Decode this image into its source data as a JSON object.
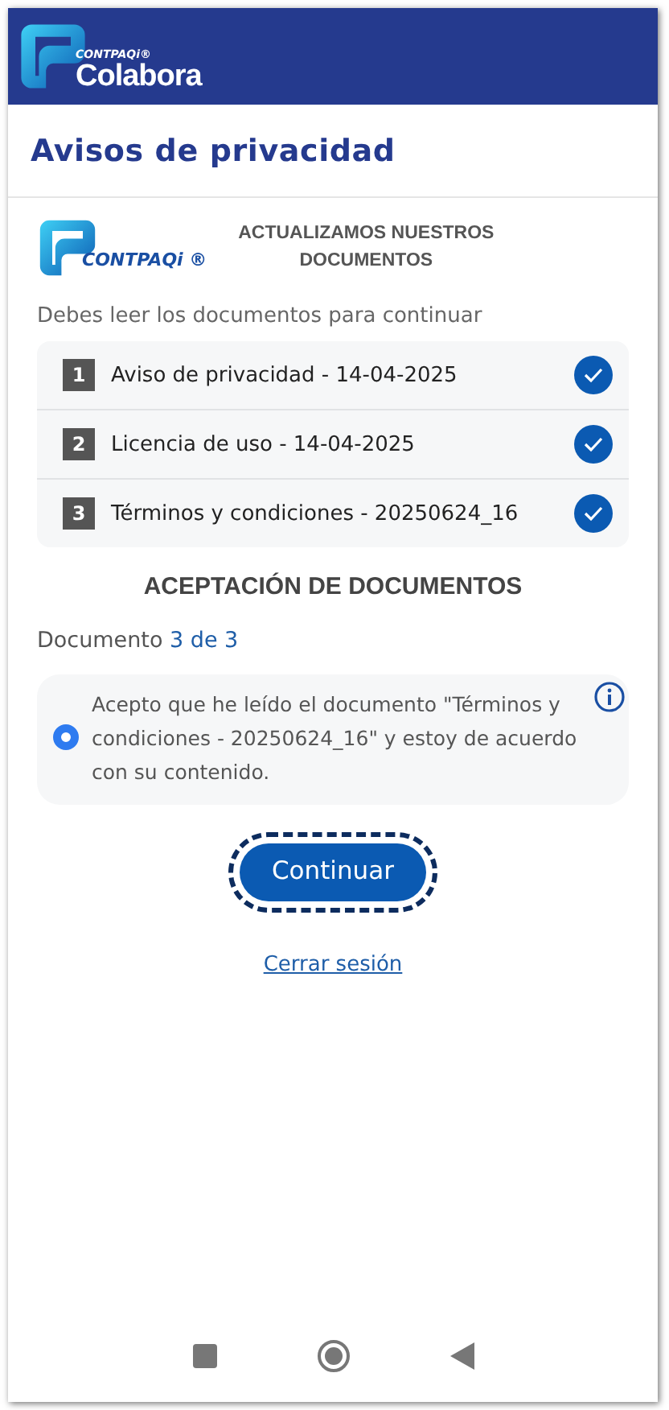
{
  "header": {
    "logo_small": "CONTPAQi®",
    "logo_name": "Colabora"
  },
  "page_title": "Avisos de privacidad",
  "banner": {
    "logo_text": "CONTPAQi ®",
    "heading": "ACTUALIZAMOS NUESTROS DOCUMENTOS"
  },
  "instructions": "Debes leer los documentos para continuar",
  "documents": [
    {
      "number": "1",
      "title": "Aviso de privacidad - 14-04-2025",
      "checked": true
    },
    {
      "number": "2",
      "title": "Licencia de uso - 14-04-2025",
      "checked": true
    },
    {
      "number": "3",
      "title": "Términos y condiciones - 20250624_16",
      "checked": true
    }
  ],
  "acceptance": {
    "heading": "ACEPTACIÓN DE DOCUMENTOS",
    "counter_label": "Documento",
    "counter_value": "3 de 3",
    "statement": "Acepto que he leído el documento \"Términos y condiciones - 20250624_16\" y estoy de acuerdo con su contenido.",
    "selected": true
  },
  "continue_button": {
    "label": "Continuar",
    "focused": true
  },
  "logout_link": "Cerrar sesión"
}
